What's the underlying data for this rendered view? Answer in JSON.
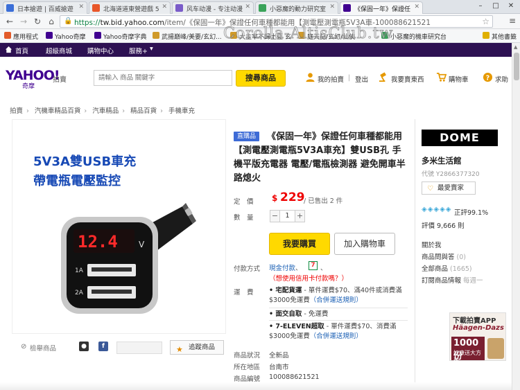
{
  "browser": {
    "tabs": [
      {
        "label": "日本搶遊 | 百威搶遊",
        "color": "#3b6fd8"
      },
      {
        "label": "北海道道東營遊戲 5",
        "color": "#e8572a"
      },
      {
        "label": "风车动漫 - 专注动漫",
        "color": "#7a5cc9"
      },
      {
        "label": "小惡魔的動力研究室",
        "color": "#3aa35a"
      },
      {
        "label": "《保固一年》保證任",
        "color": "#400090"
      }
    ],
    "url_scheme": "https://",
    "url_host": "tw.bid.yahoo.com",
    "url_path": "/item/《保固一年》保證任何車種都能用【測電壓測電瓶5V3A車-100088621521",
    "bookmarks": [
      {
        "label": "應用程式",
        "color": "#e25b2a"
      },
      {
        "label": "Yahoo奇摩",
        "color": "#400090"
      },
      {
        "label": "Yahoo奇摩字典",
        "color": "#400090"
      },
      {
        "label": "武揚巔峰/美要/玄幻...",
        "color": "#d09a2a"
      },
      {
        "label": "大主宰不歸土豆 玄",
        "color": "#d09a2a"
      },
      {
        "label": "庭天記/玄幻/仙俠",
        "color": "#d09a2a"
      },
      {
        "label": "小惡魔的機車研究台",
        "color": "#3aa35a"
      },
      {
        "label": "其他書籤",
        "color": "#e0b000"
      }
    ],
    "watermark": "Corolla-AltisClub.tw"
  },
  "ynav": {
    "items": [
      "首頁",
      "超級商城",
      "購物中心",
      "服務+"
    ]
  },
  "header": {
    "logo": "YAHOO!",
    "logo_sub": "奇摩",
    "logo_auction": "拍賣",
    "search_placeholder": "請輸入 商品 關鍵字",
    "search_button": "搜尋商品",
    "links": [
      {
        "label": "我的拍賣",
        "icon": "user-icon"
      },
      {
        "label": "登出",
        "icon": ""
      },
      {
        "label": "我要賣東西",
        "icon": "gavel-icon"
      },
      {
        "label": "購物車",
        "icon": "cart-icon"
      },
      {
        "label": "求助",
        "icon": "help-icon"
      }
    ]
  },
  "breadcrumb": [
    "拍賣",
    "汽機車精品百貨",
    "汽車精品",
    "精品百貨",
    "手機車充"
  ],
  "product_image": {
    "title_line1": "5V3A雙USB車充",
    "title_line2": "帶電瓶電壓監控",
    "display_value": "12.4",
    "display_unit": "V",
    "port1": "1A",
    "port2": "2A"
  },
  "image_actions": {
    "report": "檢舉商品",
    "favorite": "追蹤商品"
  },
  "product": {
    "tag": "直購品",
    "title": "《保固一年》保證任何車種都能用【測電壓測電瓶5V3A車充】雙USB孔 手機平版充電器 電壓/電瓶檢測器 避免開車半路熄火",
    "price_label": "定　價",
    "currency": "$",
    "price": "229",
    "sold": "/ 已售出 2 件",
    "qty_label": "數　量",
    "qty": "1",
    "buy_button": "我要購買",
    "cart_button": "加入購物車",
    "payment_label": "付款方式",
    "payment_cash": "現金付款",
    "payment_sep": "、",
    "payment_credit": "（想使用信用卡付款嗎？）",
    "shipping_label": "運　費",
    "shipping": [
      {
        "bold": "• 宅配貨運",
        "text": " - 單件運費$70、滿40件或消費滿$3000免運費",
        "rule": "（合併運送規則）"
      },
      {
        "bold": "• 面交自取",
        "text": " - 免運費",
        "rule": ""
      },
      {
        "bold": "• 7-ELEVEN超取",
        "text": " - 單件運費$70、消費滿$3000免運費",
        "rule": "（合併運送規則）"
      }
    ],
    "condition_label": "商品狀況",
    "condition": "全新品",
    "location_label": "所在地區",
    "location": "台南市",
    "id_label": "商品編號",
    "id": "100088621521"
  },
  "seller": {
    "logo": "DOME",
    "name": "多米生活館",
    "code": "代號 Y2866377320",
    "follow": "最愛賣家",
    "diamonds": "◈◈◈◈◈",
    "positive": "正評99.1%",
    "reviews": "評價 9,666 則",
    "links": [
      {
        "label": "關於我",
        "count": ""
      },
      {
        "label": "商品問與答",
        "count": "(0)"
      },
      {
        "label": "全部商品",
        "count": "(1665)"
      },
      {
        "label": "訂閱商品情報",
        "count": "每週一"
      }
    ]
  },
  "ad": {
    "line1": "下載拍賣APP",
    "line2": "Häagen-Dazs",
    "number": "1000份",
    "sub": "好康送大方送"
  }
}
